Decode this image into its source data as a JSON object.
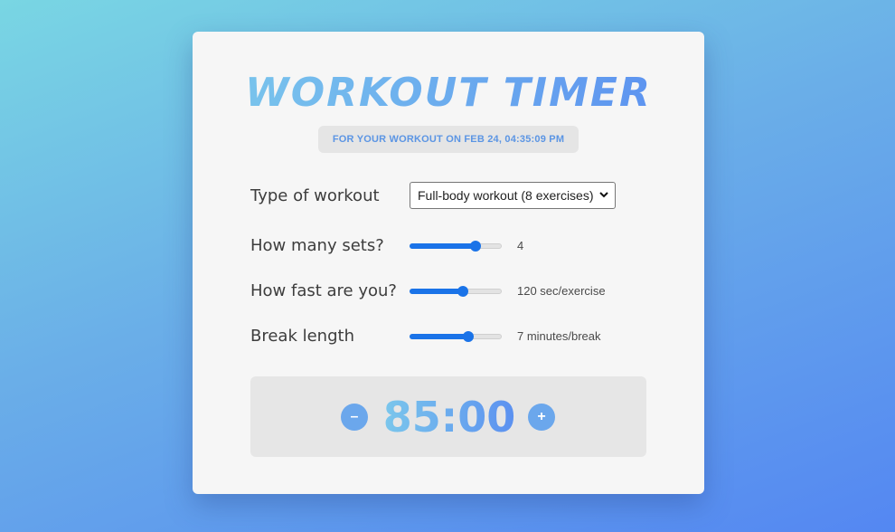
{
  "app": {
    "title": "WORKOUT TIMER",
    "subtitle": "FOR YOUR WORKOUT ON FEB 24, 04:35:09 PM"
  },
  "settings": {
    "workout_type": {
      "label": "Type of workout",
      "selected": "Full-body workout (8 exercises)"
    },
    "sets": {
      "label": "How many sets?",
      "value_text": "4",
      "level": 0.72
    },
    "speed": {
      "label": "How fast are you?",
      "value_text": "120 sec/exercise",
      "level": 0.58
    },
    "break_length": {
      "label": "Break length",
      "value_text": "7 minutes/break",
      "level": 0.64
    }
  },
  "timer": {
    "display": "85:00",
    "minus_label": "–",
    "plus_label": "+"
  },
  "colors": {
    "accent": "#1a73e8",
    "button": "#6ba7ec",
    "gradient_start": "#7cc9ec",
    "gradient_end": "#5a8ef0"
  },
  "icons": {
    "select_arrow": "chevron-down-icon"
  }
}
